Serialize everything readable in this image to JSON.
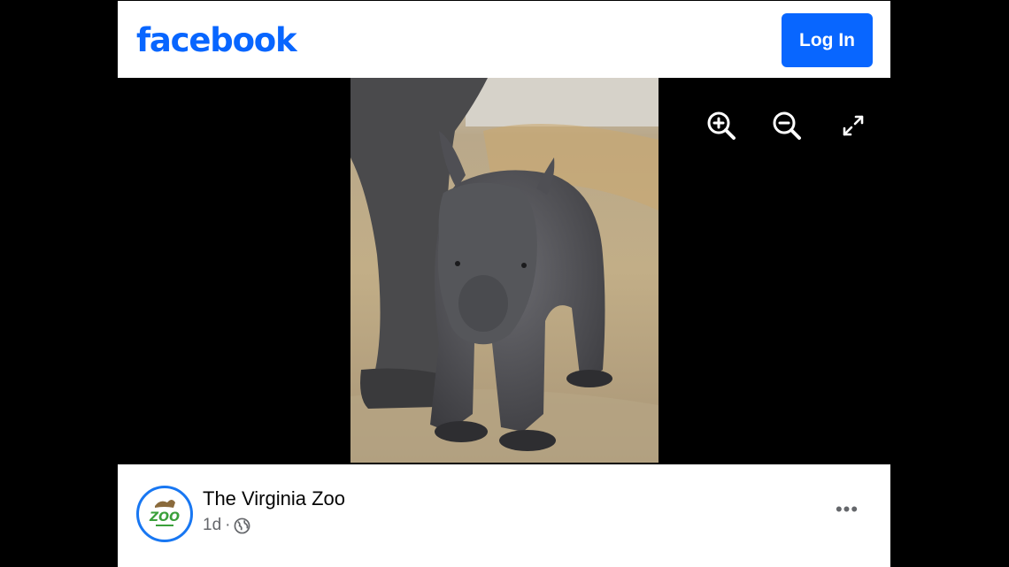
{
  "header": {
    "logo_text": "facebook",
    "login_label": "Log In",
    "brand_color": "#0866ff"
  },
  "viewer": {
    "photo_description_icon": "rhino-calf-photo",
    "tools": [
      {
        "icon": "zoom-in-icon"
      },
      {
        "icon": "zoom-out-icon"
      },
      {
        "icon": "expand-icon"
      }
    ]
  },
  "post": {
    "page_name": "The Virginia Zoo",
    "avatar_text": "ZOO",
    "timestamp": "1d",
    "separator": "·",
    "audience_icon": "globe-icon",
    "more_label": "•••"
  }
}
